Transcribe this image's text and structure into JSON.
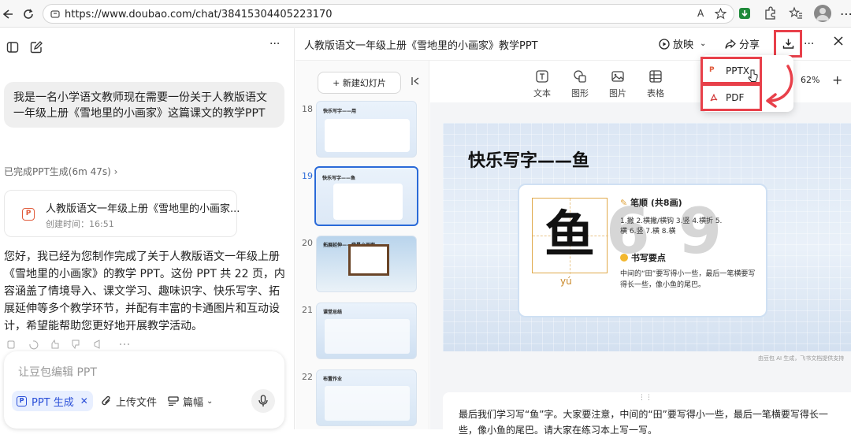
{
  "browser": {
    "url": "https://www.doubao.com/chat/38415304405223170",
    "read_aloud": "A"
  },
  "chat": {
    "user_msg": "我是一名小学语文教师现在需要一份关于人教版语文一年级上册《雪地里的小画家》这篇课文的教学PPT",
    "status": "已完成PPT生成(6m 47s)",
    "file_card": {
      "title": "人教版语文一年级上册《雪地里的小画家...",
      "time": "创建时间：16:51"
    },
    "reply": "您好，我已经为您制作完成了关于人教版语文一年级上册《雪地里的小画家》的教学 PPT。这份 PPT 共 22 页，内容涵盖了情境导入、课文学习、趣味识字、快乐写字、拓展延伸等多个教学环节，并配有丰富的卡通图片和互动设计，希望能帮助您更好地开展教学活动。",
    "input_placeholder": "让豆包编辑 PPT",
    "chips": {
      "ppt": "PPT 生成",
      "upload": "上传文件",
      "length": "篇幅"
    }
  },
  "panel": {
    "title": "人教版语文一年级上册《雪地里的小画家》教学PPT",
    "play": "放映",
    "share": "分享",
    "more": "···",
    "new_slide": "+ 新建幻灯片",
    "tools": [
      "文本",
      "图形",
      "图片",
      "表格"
    ],
    "zoom": "62%",
    "download_menu": [
      "PPTX",
      "PDF"
    ],
    "slides": [
      {
        "num": "18",
        "title": "快乐写字——用"
      },
      {
        "num": "19",
        "title": "快乐写字——鱼"
      },
      {
        "num": "20",
        "title": "拓展延伸——我是小画家"
      },
      {
        "num": "21",
        "title": "课堂总结"
      },
      {
        "num": "22",
        "title": "布置作业"
      }
    ],
    "main_slide": {
      "title": "快乐写字——鱼",
      "char": "鱼",
      "pinyin": "yú",
      "ghost": "6 9",
      "stroke_title": "笔顺 (共8画)",
      "stroke_desc": "1.撇 2.横撇/横钩 3.竖 4.横折 5.横 6.竖 7.横 8.横",
      "tip_title": "书写要点",
      "tip_desc": "中间的“田”要写得小一些，最后一笔横要写得长一些，像小鱼的尾巴。"
    },
    "footer": "由豆包 AI 生成，飞书文档提供支持",
    "notes": "最后我们学习写“鱼”字。大家要注意，中间的“田”要写得小一些，最后一笔横要写得长一些，像小鱼的尾巴。请大家在练习本上写一写。"
  },
  "colors": {
    "accent": "#2a6ad8",
    "highlight": "#e8404a",
    "ppt_orange": "#e05a3a"
  }
}
